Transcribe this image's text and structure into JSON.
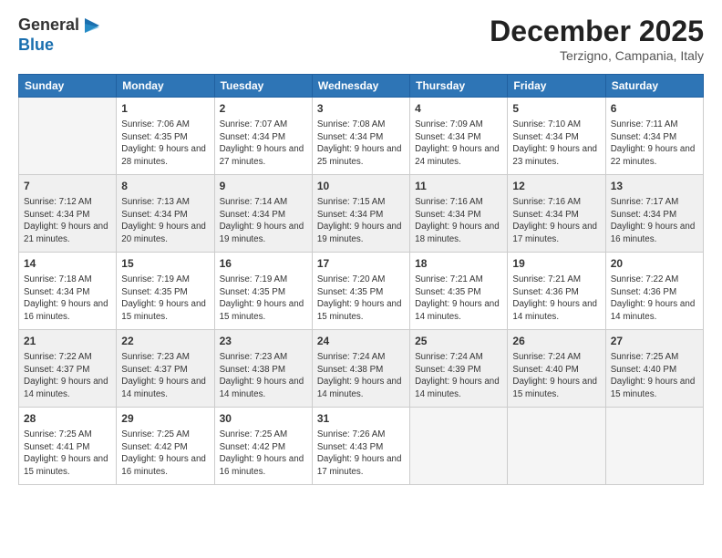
{
  "logo": {
    "general": "General",
    "blue": "Blue"
  },
  "title": "December 2025",
  "subtitle": "Terzigno, Campania, Italy",
  "weekdays": [
    "Sunday",
    "Monday",
    "Tuesday",
    "Wednesday",
    "Thursday",
    "Friday",
    "Saturday"
  ],
  "rows": [
    [
      {
        "day": "",
        "empty": true
      },
      {
        "day": "1",
        "sunrise": "Sunrise: 7:06 AM",
        "sunset": "Sunset: 4:35 PM",
        "daylight": "Daylight: 9 hours and 28 minutes."
      },
      {
        "day": "2",
        "sunrise": "Sunrise: 7:07 AM",
        "sunset": "Sunset: 4:34 PM",
        "daylight": "Daylight: 9 hours and 27 minutes."
      },
      {
        "day": "3",
        "sunrise": "Sunrise: 7:08 AM",
        "sunset": "Sunset: 4:34 PM",
        "daylight": "Daylight: 9 hours and 25 minutes."
      },
      {
        "day": "4",
        "sunrise": "Sunrise: 7:09 AM",
        "sunset": "Sunset: 4:34 PM",
        "daylight": "Daylight: 9 hours and 24 minutes."
      },
      {
        "day": "5",
        "sunrise": "Sunrise: 7:10 AM",
        "sunset": "Sunset: 4:34 PM",
        "daylight": "Daylight: 9 hours and 23 minutes."
      },
      {
        "day": "6",
        "sunrise": "Sunrise: 7:11 AM",
        "sunset": "Sunset: 4:34 PM",
        "daylight": "Daylight: 9 hours and 22 minutes."
      }
    ],
    [
      {
        "day": "7",
        "sunrise": "Sunrise: 7:12 AM",
        "sunset": "Sunset: 4:34 PM",
        "daylight": "Daylight: 9 hours and 21 minutes."
      },
      {
        "day": "8",
        "sunrise": "Sunrise: 7:13 AM",
        "sunset": "Sunset: 4:34 PM",
        "daylight": "Daylight: 9 hours and 20 minutes."
      },
      {
        "day": "9",
        "sunrise": "Sunrise: 7:14 AM",
        "sunset": "Sunset: 4:34 PM",
        "daylight": "Daylight: 9 hours and 19 minutes."
      },
      {
        "day": "10",
        "sunrise": "Sunrise: 7:15 AM",
        "sunset": "Sunset: 4:34 PM",
        "daylight": "Daylight: 9 hours and 19 minutes."
      },
      {
        "day": "11",
        "sunrise": "Sunrise: 7:16 AM",
        "sunset": "Sunset: 4:34 PM",
        "daylight": "Daylight: 9 hours and 18 minutes."
      },
      {
        "day": "12",
        "sunrise": "Sunrise: 7:16 AM",
        "sunset": "Sunset: 4:34 PM",
        "daylight": "Daylight: 9 hours and 17 minutes."
      },
      {
        "day": "13",
        "sunrise": "Sunrise: 7:17 AM",
        "sunset": "Sunset: 4:34 PM",
        "daylight": "Daylight: 9 hours and 16 minutes."
      }
    ],
    [
      {
        "day": "14",
        "sunrise": "Sunrise: 7:18 AM",
        "sunset": "Sunset: 4:34 PM",
        "daylight": "Daylight: 9 hours and 16 minutes."
      },
      {
        "day": "15",
        "sunrise": "Sunrise: 7:19 AM",
        "sunset": "Sunset: 4:35 PM",
        "daylight": "Daylight: 9 hours and 15 minutes."
      },
      {
        "day": "16",
        "sunrise": "Sunrise: 7:19 AM",
        "sunset": "Sunset: 4:35 PM",
        "daylight": "Daylight: 9 hours and 15 minutes."
      },
      {
        "day": "17",
        "sunrise": "Sunrise: 7:20 AM",
        "sunset": "Sunset: 4:35 PM",
        "daylight": "Daylight: 9 hours and 15 minutes."
      },
      {
        "day": "18",
        "sunrise": "Sunrise: 7:21 AM",
        "sunset": "Sunset: 4:35 PM",
        "daylight": "Daylight: 9 hours and 14 minutes."
      },
      {
        "day": "19",
        "sunrise": "Sunrise: 7:21 AM",
        "sunset": "Sunset: 4:36 PM",
        "daylight": "Daylight: 9 hours and 14 minutes."
      },
      {
        "day": "20",
        "sunrise": "Sunrise: 7:22 AM",
        "sunset": "Sunset: 4:36 PM",
        "daylight": "Daylight: 9 hours and 14 minutes."
      }
    ],
    [
      {
        "day": "21",
        "sunrise": "Sunrise: 7:22 AM",
        "sunset": "Sunset: 4:37 PM",
        "daylight": "Daylight: 9 hours and 14 minutes."
      },
      {
        "day": "22",
        "sunrise": "Sunrise: 7:23 AM",
        "sunset": "Sunset: 4:37 PM",
        "daylight": "Daylight: 9 hours and 14 minutes."
      },
      {
        "day": "23",
        "sunrise": "Sunrise: 7:23 AM",
        "sunset": "Sunset: 4:38 PM",
        "daylight": "Daylight: 9 hours and 14 minutes."
      },
      {
        "day": "24",
        "sunrise": "Sunrise: 7:24 AM",
        "sunset": "Sunset: 4:38 PM",
        "daylight": "Daylight: 9 hours and 14 minutes."
      },
      {
        "day": "25",
        "sunrise": "Sunrise: 7:24 AM",
        "sunset": "Sunset: 4:39 PM",
        "daylight": "Daylight: 9 hours and 14 minutes."
      },
      {
        "day": "26",
        "sunrise": "Sunrise: 7:24 AM",
        "sunset": "Sunset: 4:40 PM",
        "daylight": "Daylight: 9 hours and 15 minutes."
      },
      {
        "day": "27",
        "sunrise": "Sunrise: 7:25 AM",
        "sunset": "Sunset: 4:40 PM",
        "daylight": "Daylight: 9 hours and 15 minutes."
      }
    ],
    [
      {
        "day": "28",
        "sunrise": "Sunrise: 7:25 AM",
        "sunset": "Sunset: 4:41 PM",
        "daylight": "Daylight: 9 hours and 15 minutes."
      },
      {
        "day": "29",
        "sunrise": "Sunrise: 7:25 AM",
        "sunset": "Sunset: 4:42 PM",
        "daylight": "Daylight: 9 hours and 16 minutes."
      },
      {
        "day": "30",
        "sunrise": "Sunrise: 7:25 AM",
        "sunset": "Sunset: 4:42 PM",
        "daylight": "Daylight: 9 hours and 16 minutes."
      },
      {
        "day": "31",
        "sunrise": "Sunrise: 7:26 AM",
        "sunset": "Sunset: 4:43 PM",
        "daylight": "Daylight: 9 hours and 17 minutes."
      },
      {
        "day": "",
        "empty": true
      },
      {
        "day": "",
        "empty": true
      },
      {
        "day": "",
        "empty": true
      }
    ]
  ]
}
